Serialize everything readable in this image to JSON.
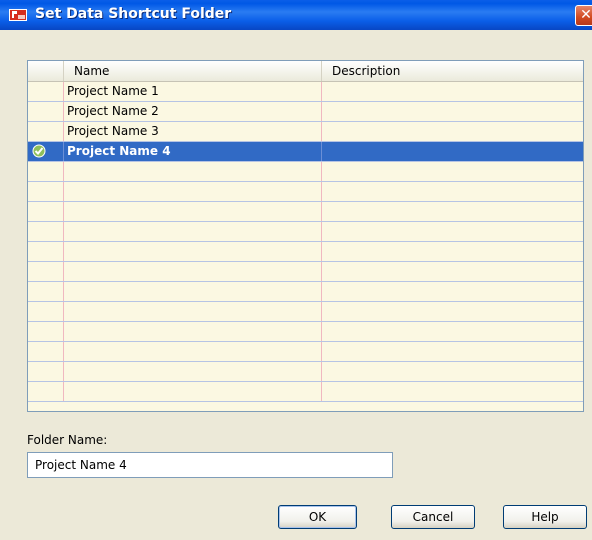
{
  "window": {
    "title": "Set Data Shortcut Folder",
    "close_glyph": "✕"
  },
  "table": {
    "columns": [
      "",
      "Name",
      "Description"
    ],
    "rows": [
      {
        "name": "Project Name 1",
        "description": "",
        "selected": false
      },
      {
        "name": "Project Name 2",
        "description": "",
        "selected": false
      },
      {
        "name": "Project Name 3",
        "description": "",
        "selected": false
      },
      {
        "name": "Project Name 4",
        "description": "",
        "selected": true
      }
    ],
    "empty_row_count": 12
  },
  "folder": {
    "label": "Folder Name:",
    "value": "Project Name 4"
  },
  "buttons": {
    "ok": "OK",
    "cancel": "Cancel",
    "help": "Help"
  },
  "colors": {
    "title_bar": "#0a5ee8",
    "selection": "#316ac5",
    "grid_bg": "#fbf8e2"
  }
}
